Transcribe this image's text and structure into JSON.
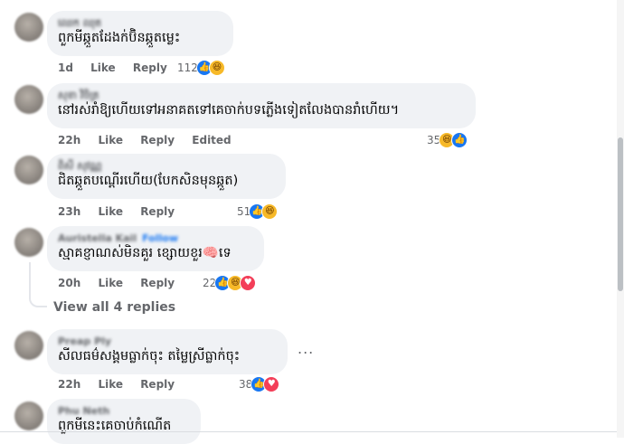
{
  "comments": [
    {
      "author": "ឈេក ឈុត",
      "text": "ពួកមីឆ្កួតដែងក់ប៊ិនឆ្កួតម្លេះ",
      "time": "1d",
      "like_label": "Like",
      "reply_label": "Reply",
      "edited_label": "",
      "reaction_count": "112",
      "reactions": [
        "like",
        "haha"
      ]
    },
    {
      "author": "សុខា វិចិត្រ",
      "text": "នៅរស់រាំឱ្យហើយទៅអនាគតទៅគេចាក់បទភ្លើងទៀតលែងបានរាំហើយ។",
      "time": "22h",
      "like_label": "Like",
      "reply_label": "Reply",
      "edited_label": "Edited",
      "reaction_count": "35",
      "reactions": [
        "haha",
        "like"
      ]
    },
    {
      "author": "ពិសី សុវណ្ណ",
      "text": "ជិតឆ្កួតបណ្ដើរហើយ(បែកសិនមុនឆ្កួត)",
      "time": "23h",
      "like_label": "Like",
      "reply_label": "Reply",
      "edited_label": "",
      "reaction_count": "51",
      "reactions": [
        "like",
        "haha"
      ]
    },
    {
      "author": "Auristella Kail",
      "follow": "Follow",
      "text": "ស្មាគខ្ញាណស់មិនគួរ ខ្សោយខួរ🧠ទេ",
      "time": "20h",
      "like_label": "Like",
      "reply_label": "Reply",
      "edited_label": "",
      "reaction_count": "22",
      "reactions": [
        "like",
        "haha",
        "love"
      ]
    },
    {
      "author": "Preap Ply",
      "text": "សីលធម៌សង្គមធ្លាក់ចុះ តម្លៃស្រីធ្លាក់ចុះ",
      "time": "22h",
      "like_label": "Like",
      "reply_label": "Reply",
      "edited_label": "",
      "reaction_count": "38",
      "reactions": [
        "like",
        "love"
      ]
    },
    {
      "author": "Phu Neth",
      "text": "ពួកមីនេះគេចាប់កំណើត",
      "time": "",
      "like_label": "",
      "reply_label": "",
      "edited_label": "",
      "reaction_count": "",
      "reactions": []
    }
  ],
  "view_replies_label": "View all 4 replies",
  "more_label": "...",
  "icons": {
    "like": "👍",
    "haha": "😆",
    "love": "♥"
  },
  "colors": {
    "bubble": "#f0f2f5",
    "meta": "#65676b",
    "like": "#1877f2",
    "haha": "#f7b928",
    "love": "#f33e58"
  }
}
